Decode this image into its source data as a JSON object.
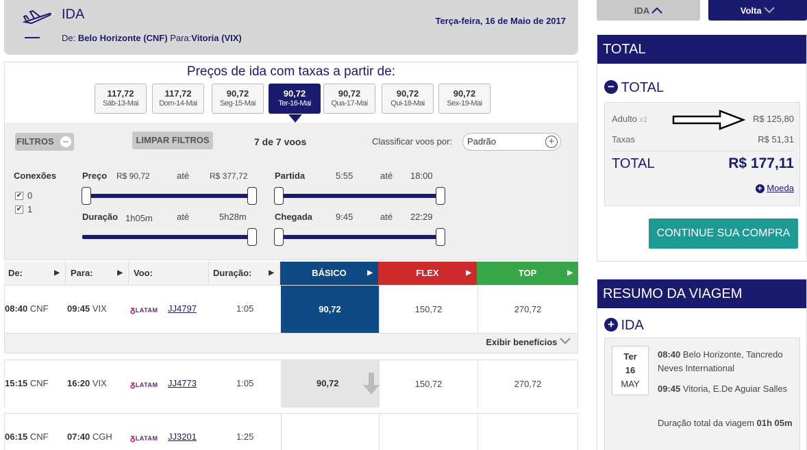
{
  "header": {
    "title": "IDA",
    "from_prefix": "De:",
    "from": "Belo Horizonte (CNF)",
    "to_prefix": "Para:",
    "to": "Vitoria (VIX)",
    "date": "Terça-feira, 16 de Maio de 2017"
  },
  "prices_title": "Preços de ida com taxas a partir de:",
  "dates": [
    {
      "price": "117,72",
      "label": "Sáb-13-Mai",
      "selected": false
    },
    {
      "price": "117,72",
      "label": "Dom-14-Mai",
      "selected": false
    },
    {
      "price": "90,72",
      "label": "Seg-15-Mai",
      "selected": false
    },
    {
      "price": "90,72",
      "label": "Ter-16-Mai",
      "selected": true
    },
    {
      "price": "90,72",
      "label": "Qua-17-Mai",
      "selected": false
    },
    {
      "price": "90,72",
      "label": "Qui-18-Mai",
      "selected": false
    },
    {
      "price": "90,72",
      "label": "Sex-19-Mai",
      "selected": false
    }
  ],
  "filters": {
    "filtros_label": "FILTROS",
    "limpar_label": "LIMPAR FILTROS",
    "count": "7 de 7 voos",
    "sort_label": "Classificar voos por:",
    "sort_value": "Padrão",
    "conexoes_label": "Conexões",
    "conexoes": [
      "0",
      "1"
    ],
    "ate": "até",
    "preco": {
      "label": "Preço",
      "min": "R$ 90,72",
      "max": "R$ 377,72"
    },
    "duracao": {
      "label": "Duração",
      "min": "1h05m",
      "max": "5h28m"
    },
    "partida": {
      "label": "Partida",
      "min": "5:55",
      "max": "18:00"
    },
    "chegada": {
      "label": "Chegada",
      "min": "9:45",
      "max": "22:29"
    }
  },
  "table": {
    "headers": {
      "de": "De:",
      "para": "Para:",
      "voo": "Voo:",
      "duracao": "Duração:",
      "basico": "BÁSICO",
      "flex": "FLEX",
      "top": "TOP"
    },
    "fare_colors": {
      "basico": "#0f4a84",
      "flex": "#cc2a2a",
      "top": "#3aa64a"
    },
    "beneficios": "Exibir benefícios",
    "rows": [
      {
        "dep_time": "08:40",
        "dep": "CNF",
        "arr_time": "09:45",
        "arr": "VIX",
        "airline": "LATAM",
        "flight": "JJ4797",
        "duration": "1:05",
        "basico": "90,72",
        "flex": "150,72",
        "top": "270,72"
      },
      {
        "dep_time": "15:15",
        "dep": "CNF",
        "arr_time": "16:20",
        "arr": "VIX",
        "airline": "LATAM",
        "flight": "JJ4773",
        "duration": "1:05",
        "basico": "90,72",
        "flex": "150,72",
        "top": "270,72"
      },
      {
        "dep_time": "06:15",
        "dep": "CNF",
        "arr_time": "07:40",
        "arr": "CGH",
        "airline": "LATAM",
        "flight": "JJ3201",
        "duration": "1:25",
        "basico": "",
        "flex": "",
        "top": ""
      }
    ]
  },
  "tabs": {
    "ida": "IDA",
    "volta": "Volta"
  },
  "total_card": {
    "header": "TOTAL",
    "section": "TOTAL",
    "adult_label": "Adulto",
    "adult_qty": "x1",
    "adult_value": "R$ 125,80",
    "taxas_label": "Taxas",
    "taxas_value": "R$ 51,31",
    "total_label": "TOTAL",
    "total_value": "R$ 177,11",
    "moeda": "Moeda",
    "continue": "CONTINUE SUA COMPRA"
  },
  "resumo": {
    "header": "RESUMO DA VIAGEM",
    "section": "IDA",
    "day_name": "Ter",
    "day_num": "16",
    "month": "MAY",
    "dep_time": "08:40",
    "dep_place": "Belo Horizonte, Tancredo Neves International",
    "arr_time": "09:45",
    "arr_place": "Vitoria, E.De Aguiar Salles",
    "duration_label": "Duração total da viagem",
    "duration_value": "01h 05m"
  }
}
